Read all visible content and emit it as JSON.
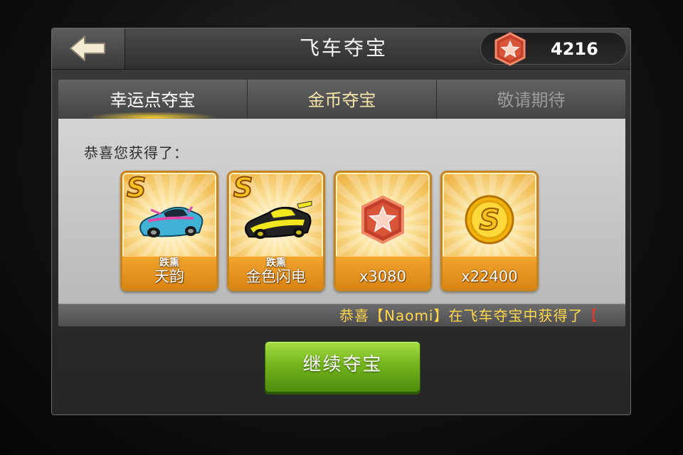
{
  "header": {
    "back_icon": "back-arrow-icon",
    "title": "飞车夺宝",
    "currency_icon": "red-star-gem-icon",
    "currency_value": "4216"
  },
  "tabs": [
    {
      "label": "幸运点夺宝",
      "state": "active"
    },
    {
      "label": "金币夺宝",
      "state": "normal"
    },
    {
      "label": "敬请期待",
      "state": "disabled"
    }
  ],
  "rewards": {
    "heading": "恭喜您获得了：",
    "items": [
      {
        "icon": "blue-sports-car-icon",
        "badge_icon": "s-rank-badge-icon",
        "subtitle": "跌熏",
        "label": "天韵"
      },
      {
        "icon": "yellow-sports-car-icon",
        "badge_icon": "s-rank-badge-icon",
        "subtitle": "跌熏",
        "label": "金色闪电"
      },
      {
        "icon": "red-star-gem-icon",
        "label": "x3080"
      },
      {
        "icon": "gold-s-coin-icon",
        "label": "x22400"
      }
    ]
  },
  "ticker": {
    "prefix": "恭喜【",
    "name": "Naomi",
    "suffix": "】在飞车夺宝中获得了",
    "tail": "【"
  },
  "actions": {
    "continue_label": "继续夺宝"
  },
  "colors": {
    "accent_green": "#74b51d",
    "card_gold": "#f0b94c",
    "ticker_yellow": "#ffd84a",
    "ticker_red": "#e23a2a"
  }
}
